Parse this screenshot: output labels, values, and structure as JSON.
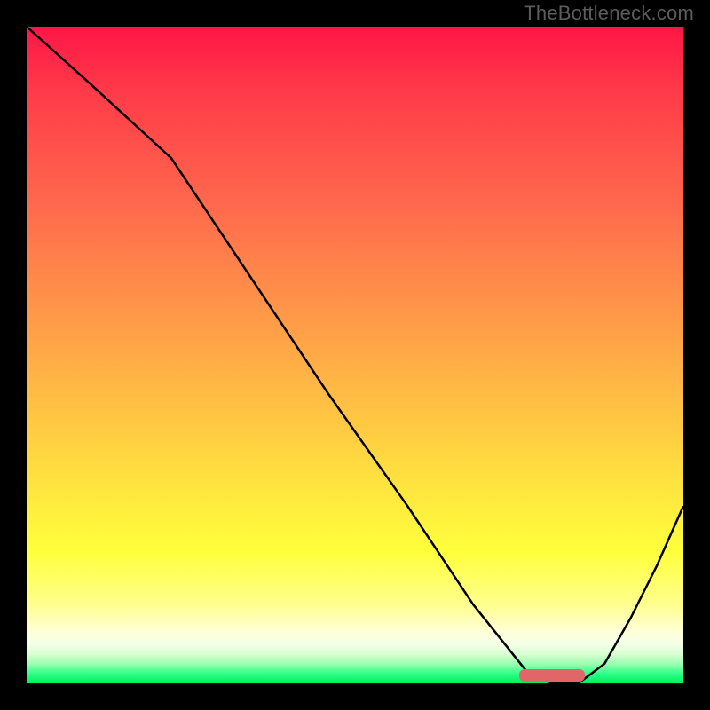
{
  "watermark": "TheBottleneck.com",
  "chart_data": {
    "type": "line",
    "title": "",
    "xlabel": "",
    "ylabel": "",
    "xlim": [
      0,
      100
    ],
    "ylim": [
      0,
      100
    ],
    "grid": false,
    "legend": false,
    "series": [
      {
        "name": "bottleneck-curve",
        "x": [
          0,
          10,
          22,
          34,
          46,
          58,
          68,
          76,
          80,
          84,
          88,
          92,
          96,
          100
        ],
        "y": [
          100,
          91,
          80,
          62,
          44,
          27,
          12,
          2,
          0,
          0,
          3,
          10,
          18,
          27
        ]
      }
    ],
    "annotations": [
      {
        "name": "optimal-marker",
        "type": "bar",
        "x_start": 75,
        "x_end": 85,
        "y": 0,
        "color": "#e06668"
      }
    ]
  }
}
